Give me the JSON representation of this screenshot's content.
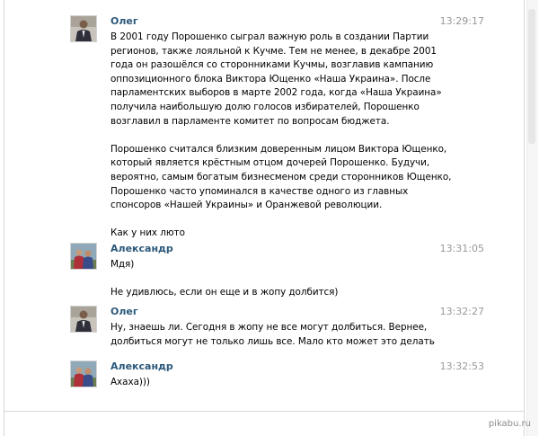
{
  "messages": [
    {
      "author": "Олег",
      "time": "13:29:17",
      "lines": [
        "В 2001 году Порошенко сыграл важную роль в создании Партии",
        "регионов, также лояльной к Кучме. Тем не менее, в декабре 2001",
        "года он разошёлся со сторонниками Кучмы, возглавив кампанию",
        "оппозиционного блока Виктора Ющенко «Наша Украина». После",
        "парламентских выборов в марте 2002 года, когда «Наша Украина»",
        "получила наибольшую долю голосов избирателей, Порошенко",
        "возглавил в парламенте комитет по вопросам бюджета.",
        "",
        "Порошенко считался близким доверенным лицом Виктора Ющенко,",
        "который является крёстным отцом дочерей Порошенко. Будучи,",
        "вероятно, самым богатым бизнесменом среди сторонников Ющенко,",
        "Порошенко часто упоминался в качестве одного из главных",
        "спонсоров «Нашей Украины» и Оранжевой революции.",
        "",
        "Как у них люто"
      ]
    },
    {
      "author": "Александр",
      "time": "13:31:05",
      "lines": [
        "Мдя)",
        "",
        "Не удивлюсь, если он еще и в жопу долбится)"
      ]
    },
    {
      "author": "Олег",
      "time": "13:32:27",
      "lines": [
        "Ну, знаешь ли. Сегодня в жопу не все могут долбиться. Вернее,",
        "долбиться могут не только лишь все. Мало кто может это делать"
      ]
    },
    {
      "author": "Александр",
      "time": "13:32:53",
      "lines": [
        "Ахаха)))"
      ]
    }
  ],
  "watermark": "pikabu.ru"
}
